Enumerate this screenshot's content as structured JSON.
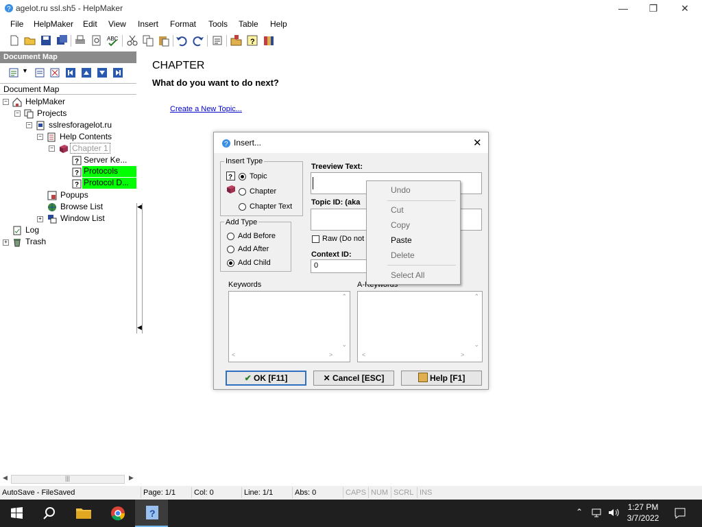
{
  "window": {
    "title": "agelot.ru ssl.sh5 - HelpMaker"
  },
  "menu": [
    "File",
    "HelpMaker",
    "Edit",
    "View",
    "Insert",
    "Format",
    "Tools",
    "Table",
    "Help"
  ],
  "document_map": {
    "header": "Document Map",
    "label": "Document Map",
    "tree": {
      "root": "HelpMaker",
      "projects": "Projects",
      "project": "sslresforagelot.ru",
      "help_contents": "Help Contents",
      "chapter": "Chapter 1",
      "topics": [
        "Server Ke...",
        "Protocols",
        "Protocol D..."
      ],
      "popups": "Popups",
      "browse_list": "Browse List",
      "window_list": "Window List",
      "log": "Log",
      "trash": "Trash"
    }
  },
  "content": {
    "heading": "CHAPTER",
    "question": "What do you want to do next?",
    "link": "Create a New Topic..."
  },
  "status": {
    "autosave": "AutoSave - FileSaved",
    "page": "Page: 1/1",
    "col": "Col: 0",
    "line": "Line: 1/1",
    "abs": "Abs: 0",
    "caps": "CAPS",
    "num": "NUM",
    "scrl": "SCRL",
    "ins": "INS"
  },
  "dialog": {
    "title": "Insert...",
    "insert_type": {
      "label": "Insert Type",
      "options": [
        "Topic",
        "Chapter",
        "Chapter Text"
      ],
      "selected": "Topic"
    },
    "add_type": {
      "label": "Add Type",
      "options": [
        "Add Before",
        "Add After",
        "Add Child"
      ],
      "selected": "Add Child"
    },
    "treeview_text": {
      "label": "Treeview Text:",
      "value": ""
    },
    "topic_id": {
      "label": "Topic ID: (aka",
      "value": ""
    },
    "raw": {
      "label": "Raw (Do not",
      "checked": false
    },
    "context_id": {
      "label": "Context ID:",
      "value": "0"
    },
    "keywords_label": "Keywords",
    "akeywords_label": "A-Keywords",
    "buttons": {
      "ok": "OK [F11]",
      "cancel": "Cancel [ESC]",
      "help": "Help [F1]"
    }
  },
  "context_menu": {
    "undo": "Undo",
    "cut": "Cut",
    "copy": "Copy",
    "paste": "Paste",
    "delete": "Delete",
    "select_all": "Select All"
  },
  "taskbar": {
    "time": "1:27 PM",
    "date": "3/7/2022"
  },
  "colors": {
    "highlight": "#00ff00",
    "link": "#0000cc",
    "taskbar": "#1f1f1f",
    "accent": "#2f6fbf"
  }
}
